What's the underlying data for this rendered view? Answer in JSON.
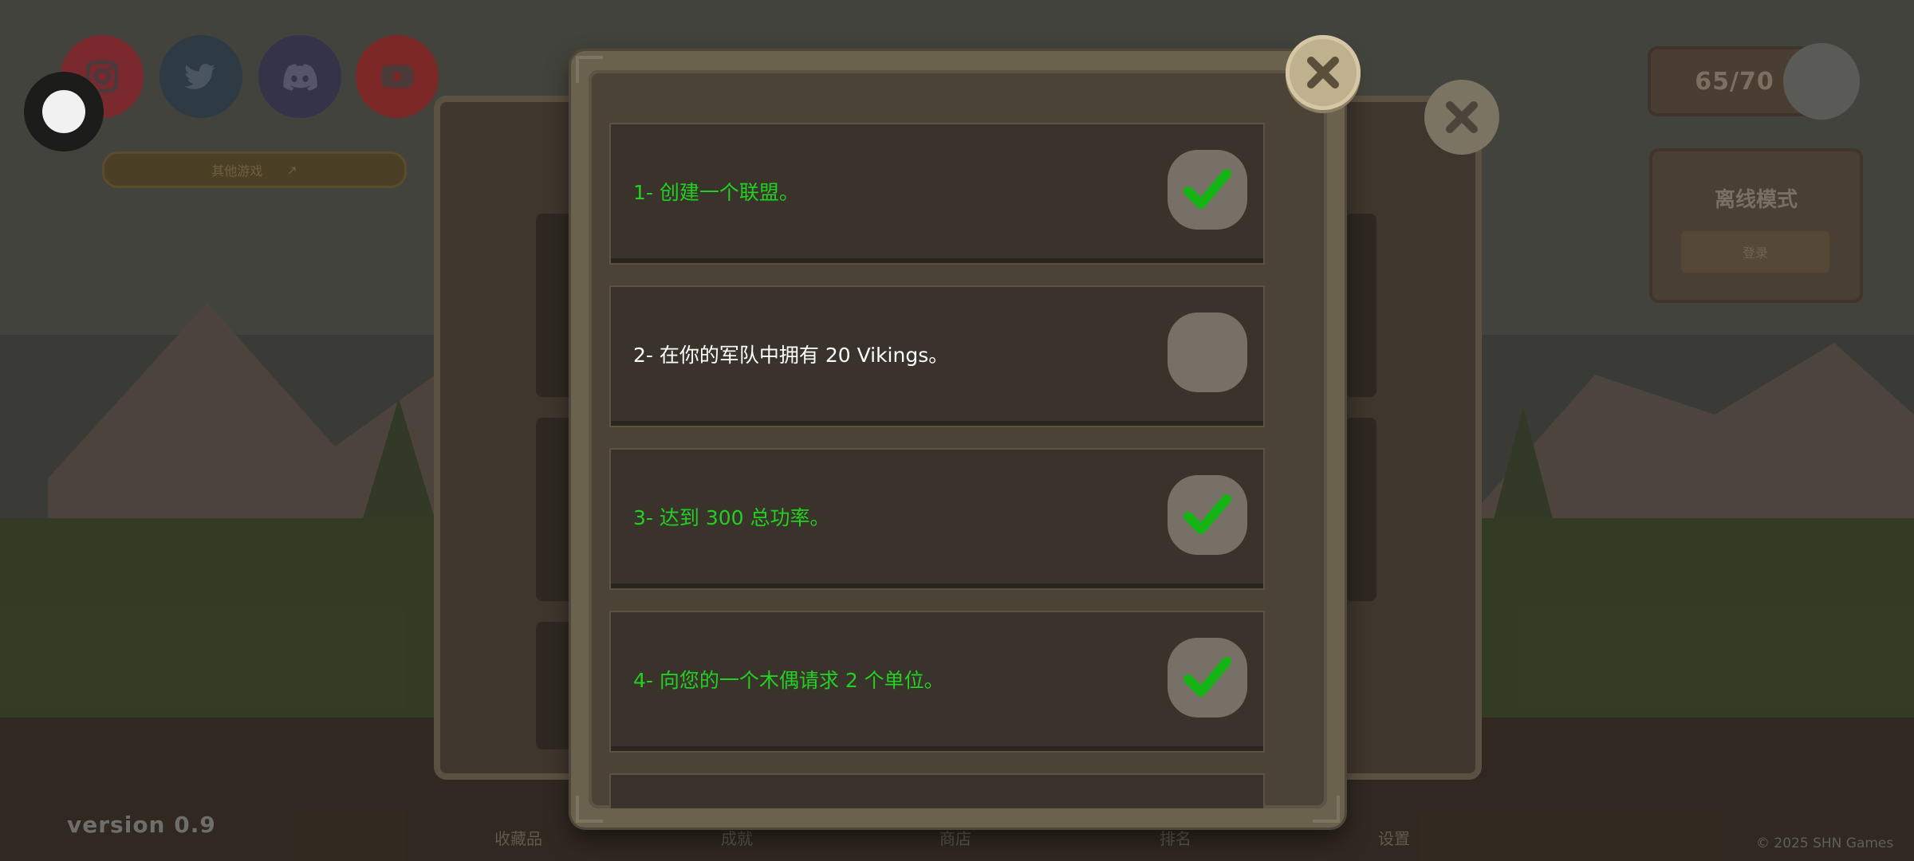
{
  "app": {
    "version": "version 0.9",
    "copyright": "© 2025 SHN Games"
  },
  "colors": {
    "completed": "#22d022",
    "pending": "#ffffff",
    "check": "#14b414"
  },
  "social": {
    "buttons": [
      {
        "name": "instagram",
        "icon": "instagram-icon",
        "color": "#7a2a2e"
      },
      {
        "name": "twitter",
        "icon": "twitter-icon",
        "color": "#2e3a44"
      },
      {
        "name": "discord",
        "icon": "discord-icon",
        "color": "#34334a"
      },
      {
        "name": "youtube",
        "icon": "youtube-icon",
        "color": "#7b2826"
      }
    ],
    "other_games_label": "其他游戏"
  },
  "top_right": {
    "counter": "65/70",
    "offline_title": "离线模式",
    "login_label": "登录"
  },
  "bottom_nav": [
    "收藏品",
    "成就",
    "商店",
    "排名",
    "设置"
  ],
  "quests": [
    {
      "text": "1- 创建一个联盟。",
      "completed": true
    },
    {
      "text": "2- 在你的军队中拥有 20 Vikings。",
      "completed": false
    },
    {
      "text": "3- 达到 300 总功率。",
      "completed": true
    },
    {
      "text": "4- 向您的一个木偶请求 2 个单位。",
      "completed": true
    }
  ]
}
